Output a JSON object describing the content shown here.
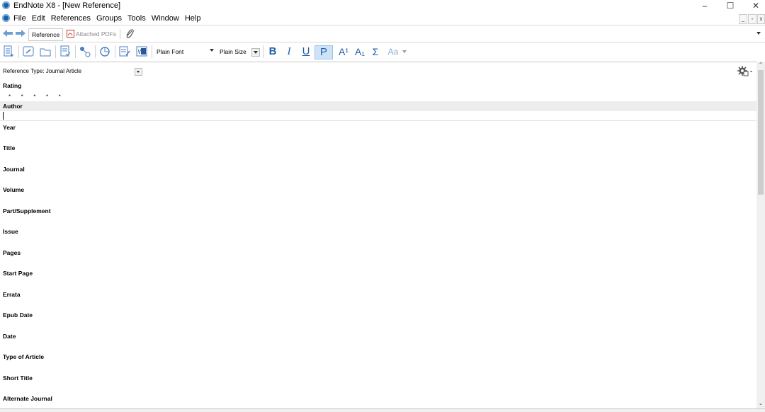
{
  "window": {
    "title": "EndNote X8 - [New Reference]",
    "minimize": "–",
    "maximize": "☐",
    "close": "✕"
  },
  "menu": {
    "items": [
      "File",
      "Edit",
      "References",
      "Groups",
      "Tools",
      "Window",
      "Help"
    ]
  },
  "mdi": {
    "minimize": "_",
    "restore": "▫",
    "close": "x"
  },
  "tabs": {
    "reference": "Reference",
    "attached_pdfs": "Attached PDFs"
  },
  "toolbar": {
    "font": "Plain Font",
    "size": "Plain Size",
    "bold": "B",
    "italic": "I",
    "underline": "U",
    "plain": "P",
    "superscript": "A¹",
    "subscript": "A₁",
    "symbol": "Σ",
    "case": "Aa"
  },
  "reference": {
    "type_label": "Reference Type:",
    "type_value": "Journal Article",
    "rating_label": "Rating",
    "rating_dots": "• • • • •",
    "fields": [
      "Author",
      "Year",
      "Title",
      "Journal",
      "Volume",
      "Part/Supplement",
      "Issue",
      "Pages",
      "Start Page",
      "Errata",
      "Epub Date",
      "Date",
      "Type of Article",
      "Short Title",
      "Alternate Journal"
    ]
  },
  "colors": {
    "accent": "#1f5fa6",
    "pressed": "#cfe3f7"
  }
}
